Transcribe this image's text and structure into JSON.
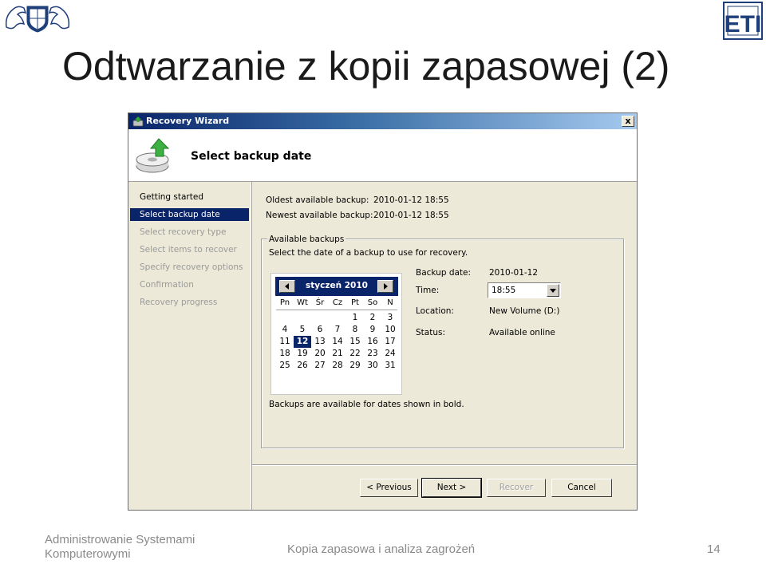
{
  "slide": {
    "title": "Odtwarzanie z kopii zapasowej (2)",
    "footer_left": "Administrowanie Systemami Komputerowymi",
    "footer_center": "Kopia zapasowa i analiza zagrożeń",
    "page_number": "14",
    "logo_right_text": "ETI"
  },
  "window": {
    "title": "Recovery Wizard",
    "close_label": "x",
    "header_title": "Select backup date"
  },
  "nav": {
    "items": [
      {
        "label": "Getting started",
        "state": "done"
      },
      {
        "label": "Select backup date",
        "state": "active"
      },
      {
        "label": "Select recovery type",
        "state": "pending"
      },
      {
        "label": "Select items to recover",
        "state": "pending"
      },
      {
        "label": "Specify recovery options",
        "state": "pending"
      },
      {
        "label": "Confirmation",
        "state": "pending"
      },
      {
        "label": "Recovery progress",
        "state": "pending"
      }
    ]
  },
  "info": {
    "oldest_label": "Oldest available backup:",
    "oldest_value": "2010-01-12 18:55",
    "newest_label": "Newest available backup:",
    "newest_value": "2010-01-12 18:55"
  },
  "group": {
    "legend": "Available backups",
    "instruction": "Select the date of a backup to use for recovery.",
    "footnote": "Backups are available for dates shown in bold."
  },
  "calendar": {
    "month": "styczeń 2010",
    "days_of_week": [
      "Pn",
      "Wt",
      "Śr",
      "Cz",
      "Pt",
      "So",
      "N"
    ],
    "weeks": [
      [
        "",
        "",
        "",
        "",
        "1",
        "2",
        "3"
      ],
      [
        "4",
        "5",
        "6",
        "7",
        "8",
        "9",
        "10"
      ],
      [
        "11",
        "12",
        "13",
        "14",
        "15",
        "16",
        "17"
      ],
      [
        "18",
        "19",
        "20",
        "21",
        "22",
        "23",
        "24"
      ],
      [
        "25",
        "26",
        "27",
        "28",
        "29",
        "30",
        "31"
      ]
    ],
    "selected_day": "12"
  },
  "details": {
    "backup_date_label": "Backup date:",
    "backup_date_value": "2010-01-12",
    "time_label": "Time:",
    "time_value": "18:55",
    "location_label": "Location:",
    "location_value": "New Volume (D:)",
    "status_label": "Status:",
    "status_value": "Available online"
  },
  "buttons": {
    "previous": "< Previous",
    "next": "Next >",
    "recover": "Recover",
    "cancel": "Cancel"
  },
  "colors": {
    "selection": "#0a246a",
    "window_bg": "#ece9d8",
    "disabled_text": "#a0a0a0"
  }
}
